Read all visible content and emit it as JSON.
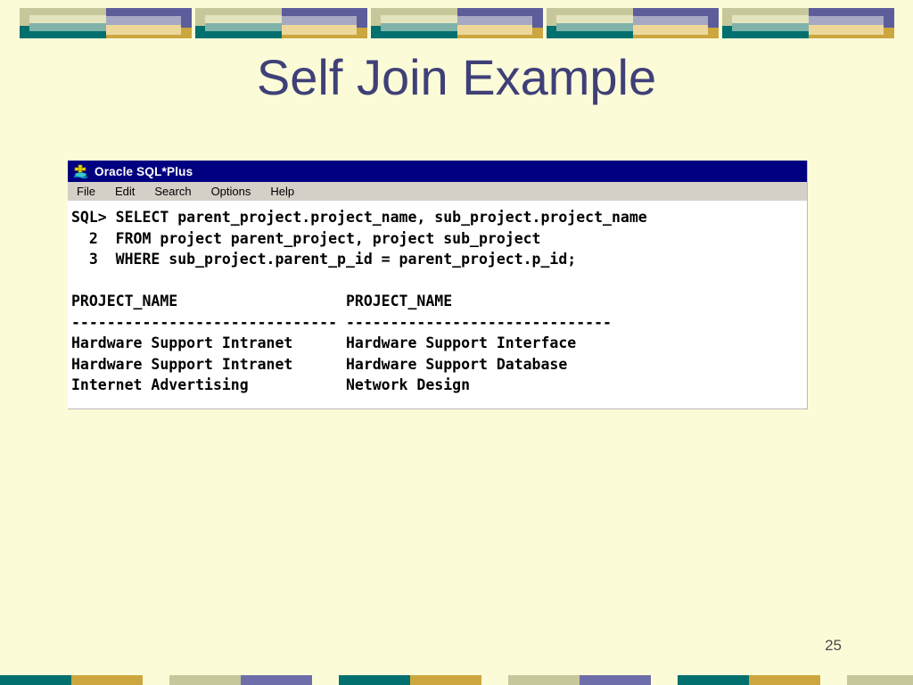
{
  "slide": {
    "title": "Self Join Example",
    "page_number": "25",
    "background_color": "#fbfbd8",
    "title_color": "#3f4077"
  },
  "decor": {
    "top_block_count": 5,
    "colors": {
      "sage": "#c6c79b",
      "teal": "#02706e",
      "teal_light": "#7fb2a8",
      "cream": "#e3e3be",
      "purple": "#5d5d9b",
      "gold": "#cca63e",
      "lavender": "#a7a9c2",
      "sand": "#edd79b"
    },
    "bottom_blocks": [
      {
        "left": "#02706e",
        "right": "#cca63e"
      },
      {
        "left": "#c6c79b",
        "right": "#6e6eaa"
      },
      {
        "left": "#02706e",
        "right": "#cca63e"
      },
      {
        "left": "#c6c79b",
        "right": "#6e6eaa"
      },
      {
        "left": "#02706e",
        "right": "#cca63e"
      },
      {
        "left": "#c6c79b",
        "right": "#6e6eaa"
      },
      {
        "left": "#02706e",
        "right": "#cca63e"
      },
      {
        "left": "#c6c79b",
        "right": "#6e6eaa"
      }
    ]
  },
  "sqlplus": {
    "title_bar": {
      "title": "Oracle SQL*Plus",
      "icon": "oracle-sqlplus-icon",
      "background_color": "#000080"
    },
    "menu": [
      {
        "label": "File"
      },
      {
        "label": "Edit"
      },
      {
        "label": "Search"
      },
      {
        "label": "Options"
      },
      {
        "label": "Help"
      }
    ],
    "terminal": {
      "lines": [
        "SQL> SELECT parent_project.project_name, sub_project.project_name",
        "  2  FROM project parent_project, project sub_project",
        "  3  WHERE sub_project.parent_p_id = parent_project.p_id;",
        "",
        "PROJECT_NAME                   PROJECT_NAME",
        "------------------------------ ------------------------------",
        "Hardware Support Intranet      Hardware Support Interface",
        "Hardware Support Intranet      Hardware Support Database",
        "Internet Advertising           Network Design"
      ],
      "result": {
        "columns": [
          "PROJECT_NAME",
          "PROJECT_NAME"
        ],
        "rows": [
          [
            "Hardware Support Intranet",
            "Hardware Support Interface"
          ],
          [
            "Hardware Support Intranet",
            "Hardware Support Database"
          ],
          [
            "Internet Advertising",
            "Network Design"
          ]
        ]
      }
    }
  }
}
